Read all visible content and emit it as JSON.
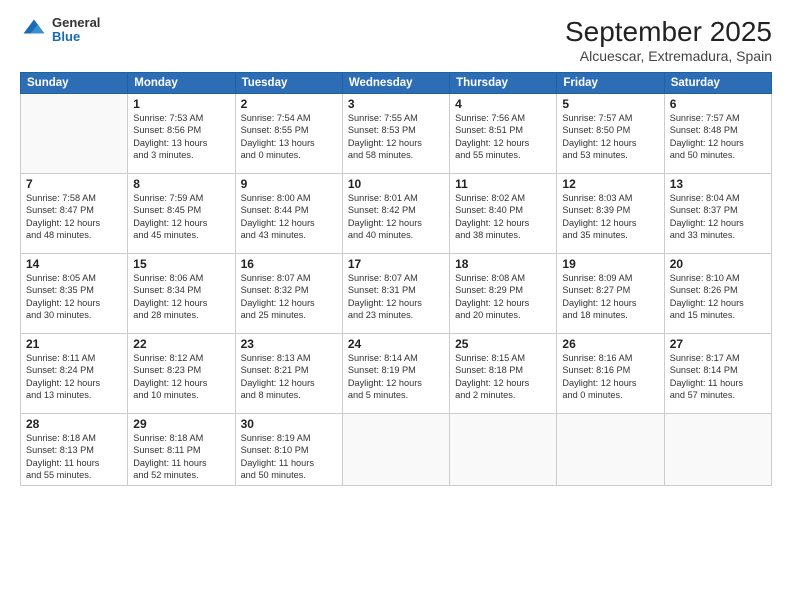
{
  "header": {
    "logo": {
      "general": "General",
      "blue": "Blue"
    },
    "title": "September 2025",
    "subtitle": "Alcuescar, Extremadura, Spain"
  },
  "days_of_week": [
    "Sunday",
    "Monday",
    "Tuesday",
    "Wednesday",
    "Thursday",
    "Friday",
    "Saturday"
  ],
  "weeks": [
    [
      {
        "day": "",
        "info": ""
      },
      {
        "day": "1",
        "info": "Sunrise: 7:53 AM\nSunset: 8:56 PM\nDaylight: 13 hours\nand 3 minutes."
      },
      {
        "day": "2",
        "info": "Sunrise: 7:54 AM\nSunset: 8:55 PM\nDaylight: 13 hours\nand 0 minutes."
      },
      {
        "day": "3",
        "info": "Sunrise: 7:55 AM\nSunset: 8:53 PM\nDaylight: 12 hours\nand 58 minutes."
      },
      {
        "day": "4",
        "info": "Sunrise: 7:56 AM\nSunset: 8:51 PM\nDaylight: 12 hours\nand 55 minutes."
      },
      {
        "day": "5",
        "info": "Sunrise: 7:57 AM\nSunset: 8:50 PM\nDaylight: 12 hours\nand 53 minutes."
      },
      {
        "day": "6",
        "info": "Sunrise: 7:57 AM\nSunset: 8:48 PM\nDaylight: 12 hours\nand 50 minutes."
      }
    ],
    [
      {
        "day": "7",
        "info": "Sunrise: 7:58 AM\nSunset: 8:47 PM\nDaylight: 12 hours\nand 48 minutes."
      },
      {
        "day": "8",
        "info": "Sunrise: 7:59 AM\nSunset: 8:45 PM\nDaylight: 12 hours\nand 45 minutes."
      },
      {
        "day": "9",
        "info": "Sunrise: 8:00 AM\nSunset: 8:44 PM\nDaylight: 12 hours\nand 43 minutes."
      },
      {
        "day": "10",
        "info": "Sunrise: 8:01 AM\nSunset: 8:42 PM\nDaylight: 12 hours\nand 40 minutes."
      },
      {
        "day": "11",
        "info": "Sunrise: 8:02 AM\nSunset: 8:40 PM\nDaylight: 12 hours\nand 38 minutes."
      },
      {
        "day": "12",
        "info": "Sunrise: 8:03 AM\nSunset: 8:39 PM\nDaylight: 12 hours\nand 35 minutes."
      },
      {
        "day": "13",
        "info": "Sunrise: 8:04 AM\nSunset: 8:37 PM\nDaylight: 12 hours\nand 33 minutes."
      }
    ],
    [
      {
        "day": "14",
        "info": "Sunrise: 8:05 AM\nSunset: 8:35 PM\nDaylight: 12 hours\nand 30 minutes."
      },
      {
        "day": "15",
        "info": "Sunrise: 8:06 AM\nSunset: 8:34 PM\nDaylight: 12 hours\nand 28 minutes."
      },
      {
        "day": "16",
        "info": "Sunrise: 8:07 AM\nSunset: 8:32 PM\nDaylight: 12 hours\nand 25 minutes."
      },
      {
        "day": "17",
        "info": "Sunrise: 8:07 AM\nSunset: 8:31 PM\nDaylight: 12 hours\nand 23 minutes."
      },
      {
        "day": "18",
        "info": "Sunrise: 8:08 AM\nSunset: 8:29 PM\nDaylight: 12 hours\nand 20 minutes."
      },
      {
        "day": "19",
        "info": "Sunrise: 8:09 AM\nSunset: 8:27 PM\nDaylight: 12 hours\nand 18 minutes."
      },
      {
        "day": "20",
        "info": "Sunrise: 8:10 AM\nSunset: 8:26 PM\nDaylight: 12 hours\nand 15 minutes."
      }
    ],
    [
      {
        "day": "21",
        "info": "Sunrise: 8:11 AM\nSunset: 8:24 PM\nDaylight: 12 hours\nand 13 minutes."
      },
      {
        "day": "22",
        "info": "Sunrise: 8:12 AM\nSunset: 8:23 PM\nDaylight: 12 hours\nand 10 minutes."
      },
      {
        "day": "23",
        "info": "Sunrise: 8:13 AM\nSunset: 8:21 PM\nDaylight: 12 hours\nand 8 minutes."
      },
      {
        "day": "24",
        "info": "Sunrise: 8:14 AM\nSunset: 8:19 PM\nDaylight: 12 hours\nand 5 minutes."
      },
      {
        "day": "25",
        "info": "Sunrise: 8:15 AM\nSunset: 8:18 PM\nDaylight: 12 hours\nand 2 minutes."
      },
      {
        "day": "26",
        "info": "Sunrise: 8:16 AM\nSunset: 8:16 PM\nDaylight: 12 hours\nand 0 minutes."
      },
      {
        "day": "27",
        "info": "Sunrise: 8:17 AM\nSunset: 8:14 PM\nDaylight: 11 hours\nand 57 minutes."
      }
    ],
    [
      {
        "day": "28",
        "info": "Sunrise: 8:18 AM\nSunset: 8:13 PM\nDaylight: 11 hours\nand 55 minutes."
      },
      {
        "day": "29",
        "info": "Sunrise: 8:18 AM\nSunset: 8:11 PM\nDaylight: 11 hours\nand 52 minutes."
      },
      {
        "day": "30",
        "info": "Sunrise: 8:19 AM\nSunset: 8:10 PM\nDaylight: 11 hours\nand 50 minutes."
      },
      {
        "day": "",
        "info": ""
      },
      {
        "day": "",
        "info": ""
      },
      {
        "day": "",
        "info": ""
      },
      {
        "day": "",
        "info": ""
      }
    ]
  ]
}
